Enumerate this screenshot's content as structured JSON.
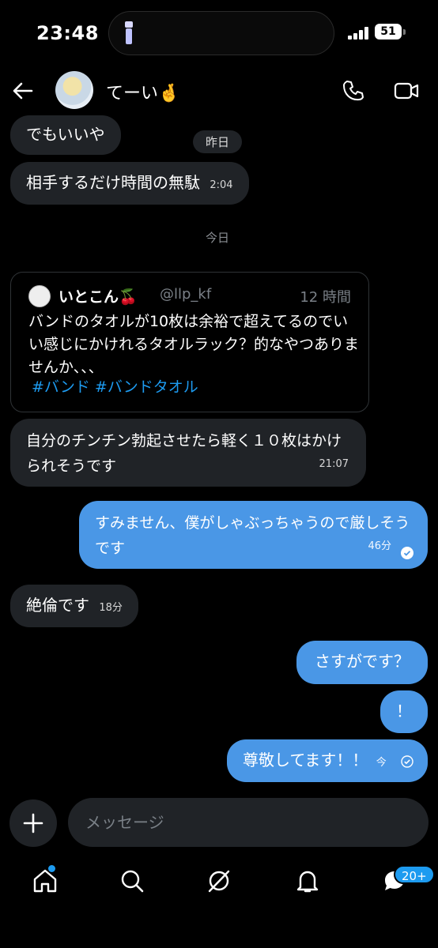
{
  "status": {
    "time": "23:48",
    "battery": "51"
  },
  "header": {
    "name": "てーい🤞"
  },
  "messages": [
    {
      "text": "でもいいや"
    },
    {
      "text": "相手するだけ時間の無駄",
      "time": "2:04"
    },
    {
      "text": "自分のチンチン勃起させたら軽く１０枚はかけられそうです",
      "time": "21:07"
    },
    {
      "text": "すみません、僕がしゃぶっちゃうので厳しそうです",
      "time": "46分"
    },
    {
      "text": "絶倫です",
      "time": "18分"
    },
    {
      "text": "さすがです？"
    },
    {
      "text": "！"
    },
    {
      "text": "尊敬してます！！",
      "time": "今"
    }
  ],
  "date_pill": "昨日",
  "date_today": "今日",
  "quote": {
    "name": "いとこん🍒",
    "handle": "@llp_kf",
    "time": "12 時間",
    "body": "バンドのタオルが10枚は余裕で超えてるのでいい感じにかけれるタオルラック？的なやつありませんか、、、",
    "tags": "#バンド #バンドタオル"
  },
  "composer": {
    "placeholder": "メッセージ"
  },
  "tabs": {
    "badge": "20+"
  }
}
